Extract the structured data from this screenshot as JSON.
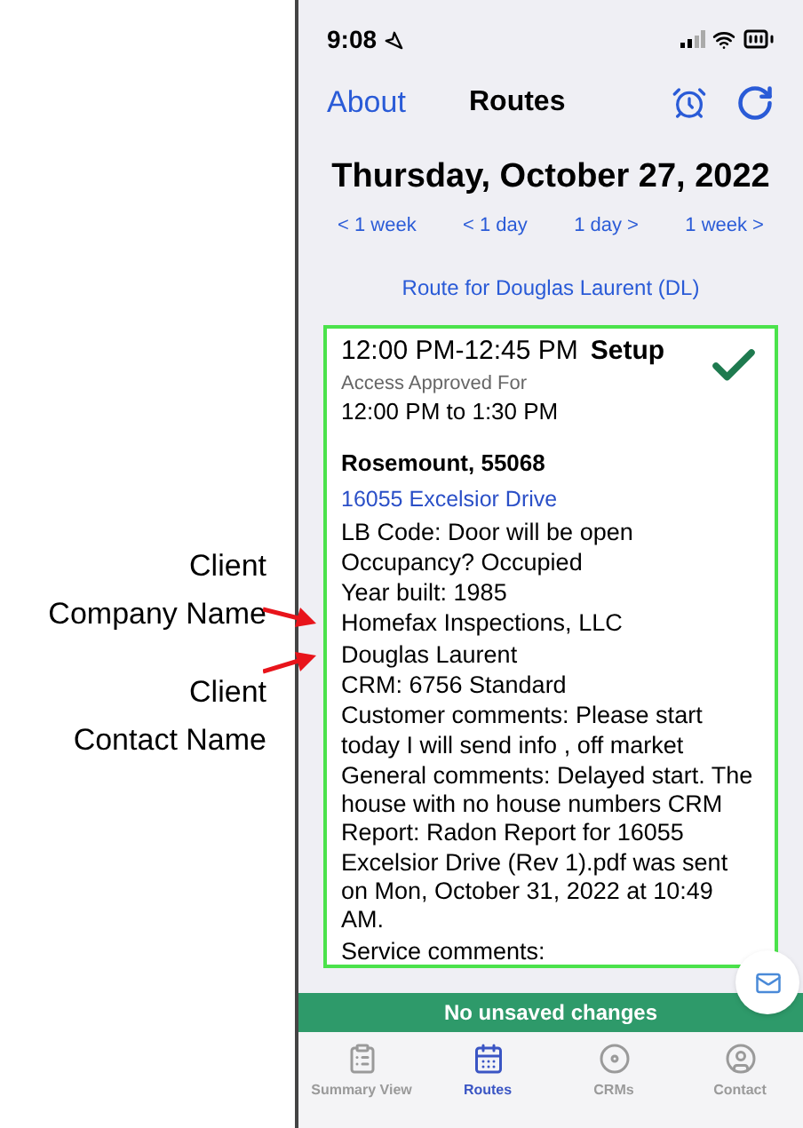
{
  "annotations": [
    {
      "lines": [
        "Client",
        "Company Name"
      ]
    },
    {
      "lines": [
        "Client",
        "Contact Name"
      ]
    }
  ],
  "status_bar": {
    "time": "9:08"
  },
  "nav": {
    "left": "About",
    "title": "Routes"
  },
  "date": "Thursday, October 27, 2022",
  "date_nav": [
    "< 1 week",
    "< 1 day",
    "1 day >",
    "1 week >"
  ],
  "route": "Route for Douglas Laurent (DL)",
  "appointment": {
    "time": "12:00 PM-12:45 PM",
    "type": "Setup",
    "completed": true,
    "access_label": "Access Approved For",
    "access_time": "12:00 PM to 1:30 PM",
    "city": "Rosemount, 55068",
    "address": "16055 Excelsior Drive",
    "details": [
      "LB Code: Door will be open",
      "Occupancy? Occupied",
      "Year built: 1985",
      "Homefax Inspections, LLC",
      "Douglas Laurent",
      "CRM: 6756 Standard",
      "Customer comments: Please start today I will send info , off market",
      "General comments: Delayed start. The house with no house numbers CRM Report: Radon Report for 16055 Excelsior Drive (Rev 1).pdf was sent on Mon, October 31, 2022 at 10:49 AM.",
      "Service comments:"
    ]
  },
  "save_status": "No unsaved changes",
  "tabs": [
    {
      "label": "Summary View",
      "kind": "summary",
      "selected": false
    },
    {
      "label": "Routes",
      "kind": "routes",
      "selected": true
    },
    {
      "label": "CRMs",
      "kind": "crms",
      "selected": false
    },
    {
      "label": "Contact",
      "kind": "contact",
      "selected": false
    }
  ]
}
